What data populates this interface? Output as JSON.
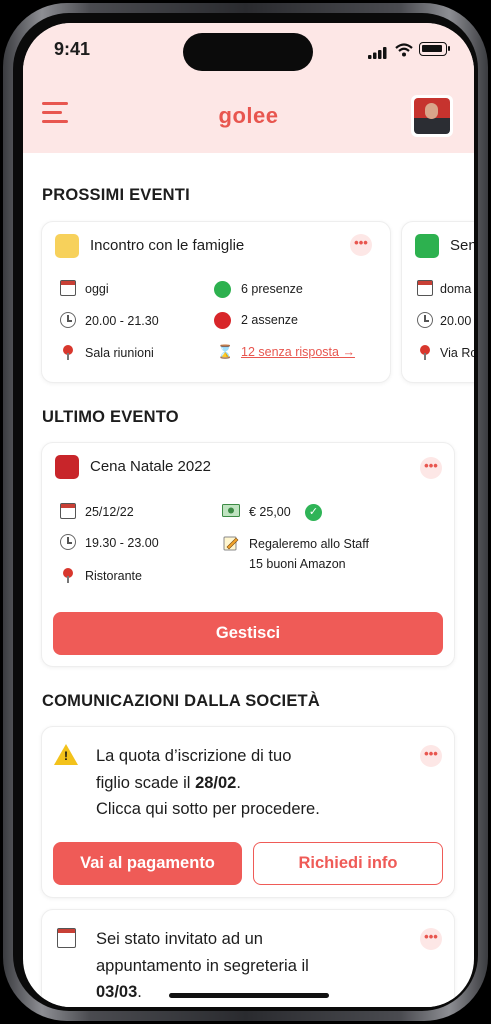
{
  "status": {
    "time": "9:41"
  },
  "header": {
    "logo": "golee"
  },
  "sections": {
    "upcoming": "PROSSIMI EVENTI",
    "last": "ULTIMO EVENTO",
    "comms": "COMUNICAZIONI DALLA SOCIETÀ"
  },
  "upcoming": [
    {
      "title": "Incontro con le famiglie",
      "color": "#f7d15b",
      "day": "oggi",
      "time": "20.00 - 21.30",
      "place": "Sala riunioni",
      "present": "6 presenze",
      "absent": "2 assenze",
      "pending": "12 senza risposta →"
    },
    {
      "title": "Sen",
      "color": "#2db14f",
      "day": "doma",
      "time": "20.00",
      "place": "Via Ro"
    }
  ],
  "last_event": {
    "title": "Cena Natale 2022",
    "color": "#c8252a",
    "date": "25/12/22",
    "time": "19.30 - 23.00",
    "place": "Ristorante",
    "amount": "€ 25,00",
    "note_1": "Regaleremo allo Staff",
    "note_2": "15 buoni Amazon",
    "manage_label": "Gestisci"
  },
  "comm1": {
    "line1": "La quota d’iscrizione di tuo",
    "line2_pre": "figlio scade il ",
    "line2_bold": "28/02",
    "line2_post": ".",
    "line3": "Clicca qui sotto per procedere.",
    "pay_label": "Vai al pagamento",
    "info_label": "Richiedi info"
  },
  "comm2": {
    "line1": "Sei stato invitato ad un",
    "line2": "appuntamento in segreteria il",
    "line3_bold": "03/03",
    "line3_post": "."
  },
  "colors": {
    "accent": "#ef5b57",
    "header_bg": "#fde7e6",
    "green": "#2db14f",
    "red": "#d8262a"
  }
}
